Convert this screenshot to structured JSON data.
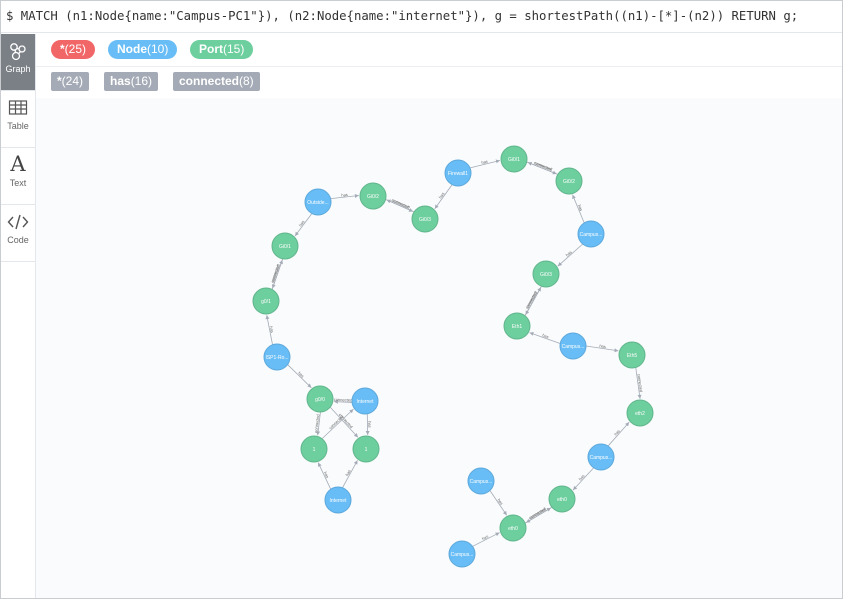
{
  "query": "$ MATCH (n1:Node{name:\"Campus-PC1\"}), (n2:Node{name:\"internet\"}), g = shortestPath((n1)-[*]-(n2)) RETURN g;",
  "sidebar": {
    "items": [
      {
        "label": "Graph",
        "icon": "graph-icon"
      },
      {
        "label": "Table",
        "icon": "table-icon"
      },
      {
        "label": "Text",
        "icon": "text-icon"
      },
      {
        "label": "Code",
        "icon": "code-icon"
      }
    ]
  },
  "labels": [
    {
      "name": "*",
      "count": "(25)",
      "color": "#f16667"
    },
    {
      "name": "Node",
      "count": "(10)",
      "color": "#68bdf6"
    },
    {
      "name": "Port",
      "count": "(15)",
      "color": "#6dce9e"
    }
  ],
  "relationships": [
    {
      "name": "*",
      "count": "(24)"
    },
    {
      "name": "has",
      "count": "(16)"
    },
    {
      "name": "connected",
      "count": "(8)"
    }
  ],
  "colors": {
    "node": "#68bdf6",
    "node_border": "#5ca8db",
    "port": "#6dce9e",
    "port_border": "#60b58b",
    "edge": "#a5abb6"
  },
  "graph": {
    "nodes": [
      {
        "id": "outside",
        "label": "Outside...",
        "type": "node"
      },
      {
        "id": "gi02a",
        "label": "Gi0/2",
        "type": "port"
      },
      {
        "id": "gi03a",
        "label": "Gi0/3",
        "type": "port"
      },
      {
        "id": "firewall",
        "label": "Firewall1",
        "type": "node"
      },
      {
        "id": "gi01a",
        "label": "Gi0/1",
        "type": "port"
      },
      {
        "id": "gi02b",
        "label": "Gi0/2",
        "type": "port"
      },
      {
        "id": "campus1",
        "label": "Campus...",
        "type": "node"
      },
      {
        "id": "gi03b",
        "label": "Gi0/3",
        "type": "port"
      },
      {
        "id": "eth1",
        "label": "Eth1",
        "type": "port"
      },
      {
        "id": "campus2",
        "label": "Campus...",
        "type": "node"
      },
      {
        "id": "eth5",
        "label": "Eth5",
        "type": "port"
      },
      {
        "id": "eth2",
        "label": "eth2",
        "type": "port"
      },
      {
        "id": "campus3",
        "label": "Campus...",
        "type": "node"
      },
      {
        "id": "eth0b",
        "label": "eth0",
        "type": "port"
      },
      {
        "id": "eth0a",
        "label": "eth0",
        "type": "port"
      },
      {
        "id": "campus4",
        "label": "Campus...",
        "type": "node"
      },
      {
        "id": "campus5",
        "label": "Campus...",
        "type": "node"
      },
      {
        "id": "gi01b",
        "label": "Gi0/1",
        "type": "port"
      },
      {
        "id": "g01",
        "label": "g0/1",
        "type": "port"
      },
      {
        "id": "isp",
        "label": "ISP1-Ro...",
        "type": "node"
      },
      {
        "id": "g00",
        "label": "g0/0",
        "type": "port"
      },
      {
        "id": "internet1",
        "label": "Internet",
        "type": "node"
      },
      {
        "id": "port1a",
        "label": "1",
        "type": "port"
      },
      {
        "id": "port1b",
        "label": "1",
        "type": "port"
      },
      {
        "id": "internet2",
        "label": "Internet",
        "type": "node"
      }
    ],
    "edges": [
      {
        "from": "outside",
        "to": "gi02a",
        "label": "has"
      },
      {
        "from": "gi02a",
        "to": "gi03a",
        "label": "connected"
      },
      {
        "from": "gi03a",
        "to": "gi02a",
        "label": "connected"
      },
      {
        "from": "firewall",
        "to": "gi03a",
        "label": "has"
      },
      {
        "from": "firewall",
        "to": "gi01a",
        "label": "has"
      },
      {
        "from": "gi01a",
        "to": "gi02b",
        "label": "connected"
      },
      {
        "from": "gi02b",
        "to": "gi01a",
        "label": "connected"
      },
      {
        "from": "campus1",
        "to": "gi02b",
        "label": "has"
      },
      {
        "from": "campus1",
        "to": "gi03b",
        "label": "has"
      },
      {
        "from": "gi03b",
        "to": "eth1",
        "label": "connected"
      },
      {
        "from": "eth1",
        "to": "gi03b",
        "label": "connected"
      },
      {
        "from": "campus2",
        "to": "eth1",
        "label": "has"
      },
      {
        "from": "campus2",
        "to": "eth5",
        "label": "has"
      },
      {
        "from": "eth5",
        "to": "eth2",
        "label": "connected"
      },
      {
        "from": "campus3",
        "to": "eth2",
        "label": "has"
      },
      {
        "from": "campus3",
        "to": "eth0b",
        "label": "has"
      },
      {
        "from": "eth0b",
        "to": "eth0a",
        "label": "connected"
      },
      {
        "from": "eth0a",
        "to": "eth0b",
        "label": "connected"
      },
      {
        "from": "campus4",
        "to": "eth0a",
        "label": "has"
      },
      {
        "from": "campus5",
        "to": "eth0a",
        "label": "has"
      },
      {
        "from": "outside",
        "to": "gi01b",
        "label": "has"
      },
      {
        "from": "gi01b",
        "to": "g01",
        "label": "connected"
      },
      {
        "from": "g01",
        "to": "gi01b",
        "label": "connected"
      },
      {
        "from": "isp",
        "to": "g01",
        "label": "has"
      },
      {
        "from": "isp",
        "to": "g00",
        "label": "has"
      },
      {
        "from": "g00",
        "to": "port1a",
        "label": "connected"
      },
      {
        "from": "g00",
        "to": "port1b",
        "label": "connected"
      },
      {
        "from": "internet1",
        "to": "g00",
        "label": "connected"
      },
      {
        "from": "internet1",
        "to": "port1b",
        "label": "has"
      },
      {
        "from": "port1a",
        "to": "internet1",
        "label": "connected"
      },
      {
        "from": "internet2",
        "to": "port1a",
        "label": "has"
      },
      {
        "from": "internet2",
        "to": "port1b",
        "label": "has"
      }
    ]
  }
}
